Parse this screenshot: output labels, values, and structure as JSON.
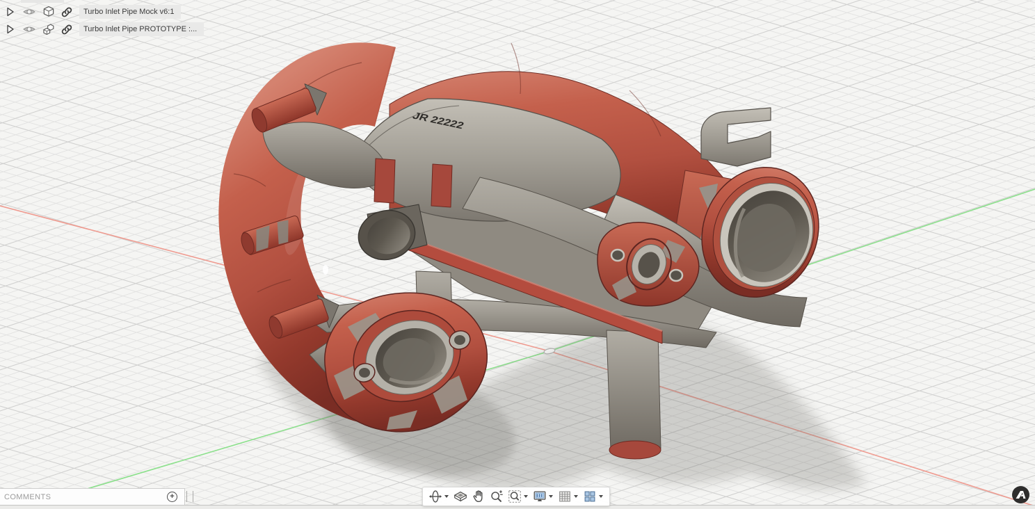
{
  "browser": {
    "items": [
      {
        "label": "Turbo Inlet Pipe Mock v6:1",
        "type_icon": "body-cube-icon",
        "visibility_icon": "eye-icon",
        "link_icon": "link-icon"
      },
      {
        "label": "Turbo Inlet Pipe PROTOTYPE :...",
        "type_icon": "component-icon",
        "visibility_icon": "eye-icon",
        "link_icon": "link-icon"
      }
    ]
  },
  "viewport": {
    "model": {
      "name": "Turbo Inlet Pipe",
      "embossed_text": "JR 22222",
      "body_color": "#b55444",
      "heat_shield_color": "#a29e95",
      "bore_color": "#57524a"
    },
    "axes": {
      "x_axis_color": "#ef9b90",
      "y_axis_color": "#8ce08c"
    },
    "grid": {
      "minor_color": "#e3e3e2",
      "major_color": "#d0d0cf"
    }
  },
  "comments_bar": {
    "label": "COMMENTS",
    "add_button_label": "+"
  },
  "nav_toolbar": {
    "buttons": [
      {
        "id": "orbit",
        "has_dropdown": true
      },
      {
        "id": "look-at",
        "has_dropdown": false
      },
      {
        "id": "pan",
        "has_dropdown": false
      },
      {
        "id": "zoom",
        "has_dropdown": false
      },
      {
        "id": "fit",
        "has_dropdown": true
      },
      {
        "id": "display-settings",
        "has_dropdown": true
      },
      {
        "id": "grid-and-snaps",
        "has_dropdown": true
      },
      {
        "id": "viewports",
        "has_dropdown": true
      }
    ]
  },
  "badge": {
    "icon": "autodesk-logo"
  }
}
